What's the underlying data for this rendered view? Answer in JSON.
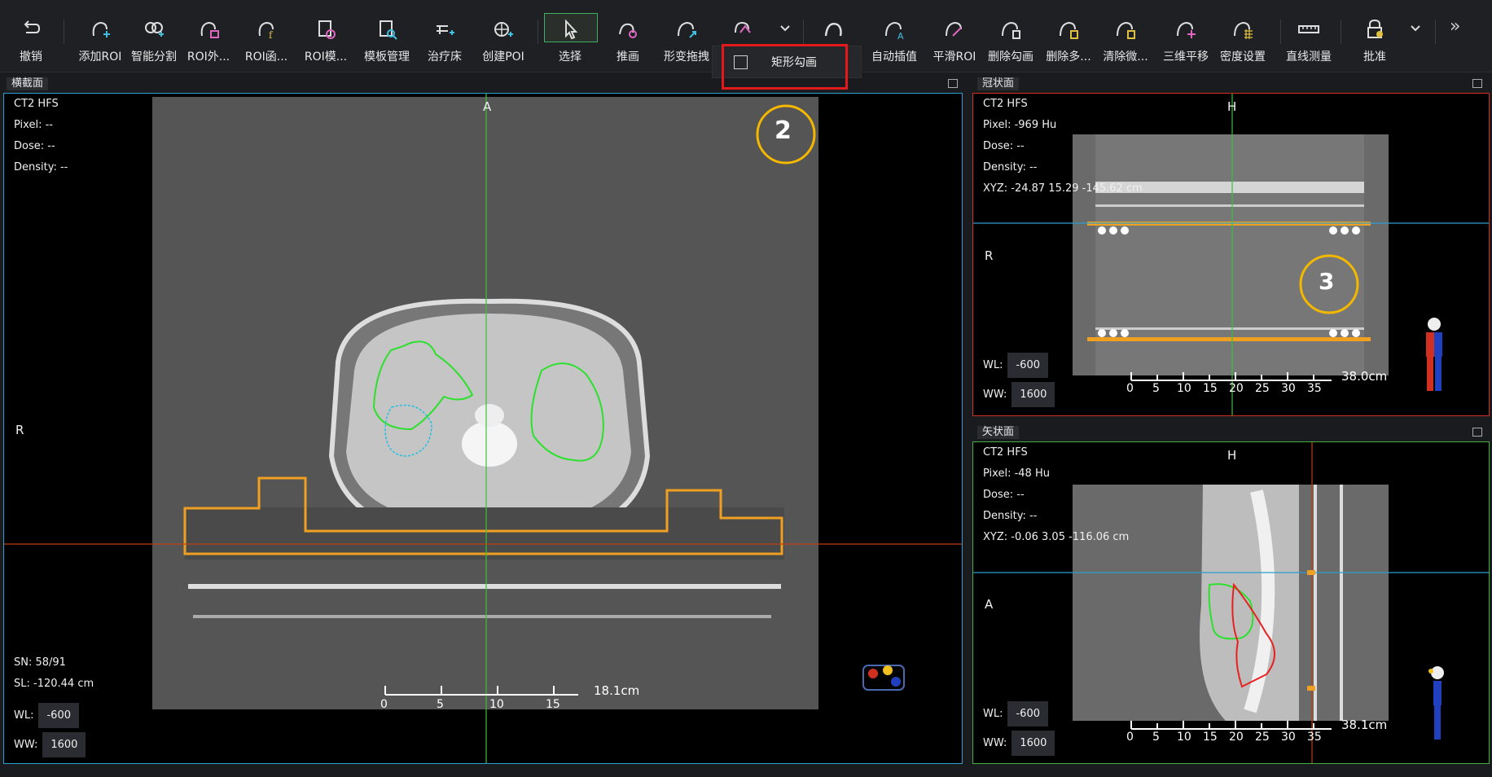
{
  "toolbar": {
    "tools": [
      {
        "name": "undo",
        "label": "撤销"
      },
      {
        "name": "add-roi",
        "label": "添加ROI"
      },
      {
        "name": "smart-seg",
        "label": "智能分割"
      },
      {
        "name": "roi-outer",
        "label": "ROI外..."
      },
      {
        "name": "roi-func",
        "label": "ROI函..."
      },
      {
        "name": "roi-template",
        "label": "ROI模..."
      },
      {
        "name": "template-mgr",
        "label": "模板管理"
      },
      {
        "name": "couch",
        "label": "治疗床"
      },
      {
        "name": "create-poi",
        "label": "创建POI"
      },
      {
        "name": "select",
        "label": "选择"
      },
      {
        "name": "push",
        "label": "推画"
      },
      {
        "name": "deform-drag",
        "label": "形变拖拽"
      },
      {
        "name": "auto-interp",
        "label": "自动插值"
      },
      {
        "name": "smooth-roi",
        "label": "平滑ROI"
      },
      {
        "name": "delete-contour",
        "label": "删除勾画"
      },
      {
        "name": "delete-multi",
        "label": "删除多..."
      },
      {
        "name": "clear-micro",
        "label": "清除微..."
      },
      {
        "name": "shift-3d",
        "label": "三维平移"
      },
      {
        "name": "density",
        "label": "密度设置"
      },
      {
        "name": "line-measure",
        "label": "直线测量"
      },
      {
        "name": "approve",
        "label": "批准"
      }
    ],
    "dropdown_item": "矩形勾画",
    "more_glyph": "»"
  },
  "axial": {
    "title": "横截面",
    "series": "CT2 HFS",
    "pixel": "Pixel: --",
    "dose": "Dose: --",
    "density": "Density: --",
    "orient_top": "A",
    "orient_left": "R",
    "sn": "SN: 58/91",
    "sl": "SL: -120.44 cm",
    "wl_label": "WL:",
    "wl": "-600",
    "ww_label": "WW:",
    "ww": "1600",
    "scale": "18.1cm",
    "ticks": [
      "0",
      "5",
      "10",
      "15"
    ]
  },
  "coronal": {
    "title": "冠状面",
    "series": "CT2 HFS",
    "pixel": "Pixel: -969 Hu",
    "dose": "Dose: --",
    "density": "Density: --",
    "xyz": "XYZ: -24.87 15.29 -145.62 cm",
    "orient_top": "H",
    "orient_left": "R",
    "wl_label": "WL:",
    "wl": "-600",
    "ww_label": "WW:",
    "ww": "1600",
    "scale": "38.0cm",
    "ticks": [
      "0",
      "5",
      "10",
      "15",
      "20",
      "25",
      "30",
      "35"
    ]
  },
  "sagittal": {
    "title": "矢状面",
    "series": "CT2 HFS",
    "pixel": "Pixel: -48 Hu",
    "dose": "Dose: --",
    "density": "Density: --",
    "xyz": "XYZ: -0.06 3.05 -116.06 cm",
    "orient_top": "H",
    "orient_left": "A",
    "wl_label": "WL:",
    "wl": "-600",
    "ww_label": "WW:",
    "ww": "1600",
    "scale": "38.1cm",
    "ticks": [
      "0",
      "5",
      "10",
      "15",
      "20",
      "25",
      "30",
      "35"
    ]
  },
  "annotations": {
    "two": "2",
    "three": "3"
  },
  "colors": {
    "accent_yellow": "#f5b800",
    "couch_orange": "#f0a020",
    "roi_green": "#2ee02e",
    "roi_red": "#e82020",
    "roi_cyan": "#20c0e0",
    "axial_border": "#2a9fd0",
    "coronal_border": "#d03020",
    "sagittal_border": "#40b040"
  }
}
